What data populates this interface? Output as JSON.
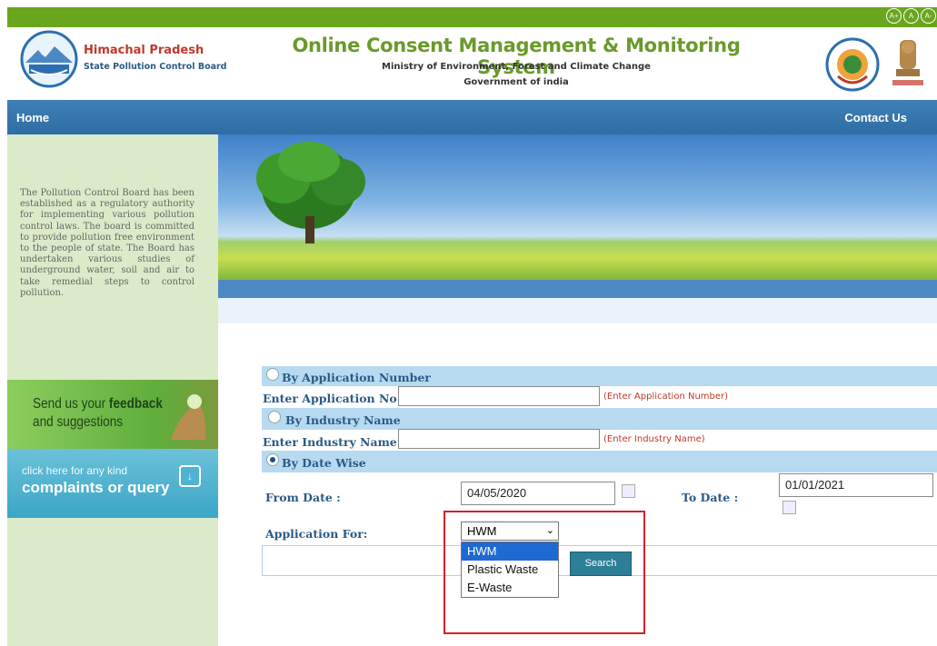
{
  "header": {
    "org_name": "Himachal Pradesh",
    "org_subtitle": "State Pollution Control Board",
    "title": "Online Consent Management & Monitoring System",
    "ministry": "Ministry of Environment, Forest and Climate Change",
    "government": "Government of india",
    "font_buttons": [
      "A+",
      "A",
      "A-"
    ]
  },
  "nav": {
    "home": "Home",
    "contact": "Contact Us"
  },
  "sidebar": {
    "about_text": "The Pollution Control Board has been established as a regulatory authority for implementing various pollution control laws. The board is committed to provide pollution free environment to the people of state. The Board has undertaken various studies of underground water, soil and air to take remedial steps to control pollution.",
    "feedback_line1": "Send us your ",
    "feedback_bold": "feedback",
    "feedback_line2": "and suggestions",
    "complaints_line1": "click here for any kind",
    "complaints_line2": "complaints or query"
  },
  "form": {
    "by_app_number": "By Application Number",
    "app_no_label": "Enter Application No:",
    "app_no_hint": "(Enter Application Number)",
    "by_industry": "By Industry Name",
    "industry_label": "Enter Industry Name:",
    "industry_hint": "(Enter Industry Name)",
    "by_date": "By Date Wise",
    "from_label": "From Date :",
    "from_value": "04/05/2020",
    "to_label": "To Date :",
    "to_value": "01/01/2021",
    "app_for_label": "Application For:",
    "selected": "HWM",
    "options": [
      "HWM",
      "Plastic Waste",
      "E-Waste"
    ],
    "search": "Search"
  },
  "colors": {
    "green": "#6aa51e",
    "blue_nav": "#2f6ea4",
    "title_green": "#6a9a2a",
    "highlight": "#d6202a"
  }
}
